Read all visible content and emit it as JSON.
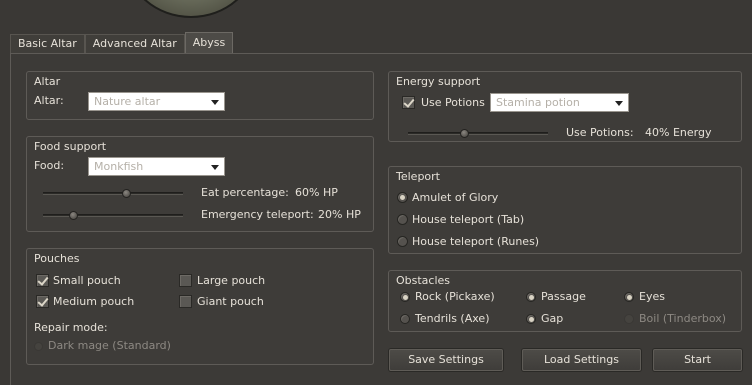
{
  "tabs": [
    "Basic Altar",
    "Advanced Altar",
    "Abyss"
  ],
  "altar": {
    "title": "Altar",
    "label": "Altar:",
    "value": "Nature altar"
  },
  "food": {
    "title": "Food support",
    "label": "Food:",
    "value": "Monkfish",
    "eat_label": "Eat percentage:",
    "eat_value": "60% HP",
    "eat_percent": 60,
    "tele_label": "Emergency teleport:",
    "tele_value": "20% HP",
    "tele_percent": 20
  },
  "pouches": {
    "title": "Pouches",
    "small": "Small pouch",
    "medium": "Medium pouch",
    "large": "Large pouch",
    "giant": "Giant pouch",
    "small_checked": true,
    "medium_checked": true,
    "large_checked": false,
    "giant_checked": false,
    "repair_label": "Repair mode:",
    "repair_option": "Dark mage (Standard)"
  },
  "energy": {
    "title": "Energy support",
    "use_potions": "Use Potions",
    "use_potions_checked": true,
    "potion": "Stamina potion",
    "slider_label": "Use Potions:",
    "slider_value": "40% Energy",
    "slider_percent": 40
  },
  "teleport": {
    "title": "Teleport",
    "options": [
      "Amulet of Glory",
      "House teleport (Tab)",
      "House teleport (Runes)"
    ],
    "selected": 0
  },
  "obstacles": {
    "title": "Obstacles",
    "rock": "Rock (Pickaxe)",
    "passage": "Passage",
    "eyes": "Eyes",
    "tendrils": "Tendrils (Axe)",
    "gap": "Gap",
    "boil": "Boil (Tinderbox)"
  },
  "buttons": {
    "save": "Save Settings",
    "load": "Load Settings",
    "start": "Start"
  },
  "colors": {
    "background": "#3a3835",
    "text": "#e6e1d8",
    "disabled_text": "#8d8983"
  }
}
